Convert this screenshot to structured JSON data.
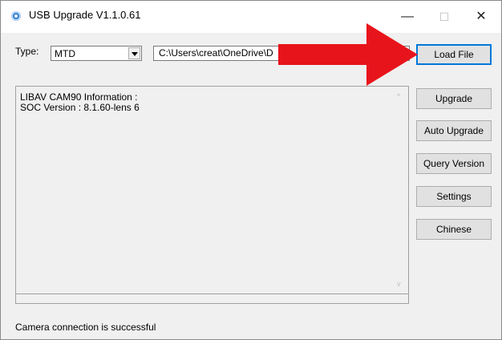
{
  "window": {
    "title": "USB Upgrade V1.1.0.61",
    "controls": {
      "minimize": "—",
      "maximize": "☐",
      "close": "✕"
    }
  },
  "form": {
    "type_label": "Type:",
    "type_value": "MTD",
    "path_value": "C:\\Users\\creat\\OneDrive\\D"
  },
  "buttons": {
    "load_file": "Load File",
    "upgrade": "Upgrade",
    "auto_upgrade": "Auto Upgrade",
    "query_version": "Query Version",
    "settings": "Settings",
    "chinese": "Chinese"
  },
  "log": {
    "text": "LIBAV CAM90 Information :\nSOC Version : 8.1.60-lens 6"
  },
  "status": "Camera connection is successful",
  "colors": {
    "annotation_arrow": "#e8141b",
    "focus_border": "#0078d7"
  }
}
